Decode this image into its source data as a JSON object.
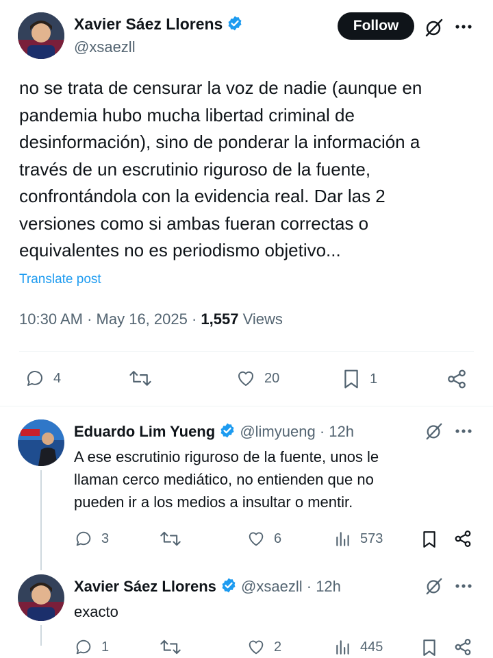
{
  "main_tweet": {
    "author_name": "Xavier Sáez Llorens",
    "handle": "@xsaezll",
    "follow_label": "Follow",
    "lines": [
      "no se trata de censurar la voz de nadie (aunque en",
      "pandemia hubo mucha libertad criminal de",
      "desinformación), sino de ponderar la información a",
      "través de un escrutinio riguroso de la fuente,",
      "confrontándola con la evidencia real. Dar las 2",
      "versiones como si ambas fueran correctas o",
      "equivalentes no es periodismo objetivo..."
    ],
    "translate_label": "Translate post",
    "time": "10:30 AM",
    "date": "May 16, 2025",
    "views_count": "1,557",
    "views_label": "Views",
    "replies": "4",
    "likes": "20",
    "bookmarks": "1"
  },
  "reply_1": {
    "author_name": "Eduardo Lim Yueng",
    "handle": "@limyueng",
    "time": "12h",
    "lines": [
      "A ese escrutinio riguroso de la fuente, unos le",
      "llaman cerco mediático, no entienden que no",
      "pueden ir a los medios a insultar o mentir."
    ],
    "replies": "3",
    "likes": "6",
    "views": "573"
  },
  "reply_2": {
    "author_name": "Xavier Sáez Llorens",
    "handle": "@xsaezll",
    "time": "12h",
    "text": "exacto",
    "replies": "1",
    "likes": "2",
    "views": "445"
  },
  "separator": "·",
  "colors": {
    "verified": "#1d9bf0",
    "link": "#1d9bf0",
    "muted": "#536471",
    "text": "#0f1419"
  }
}
